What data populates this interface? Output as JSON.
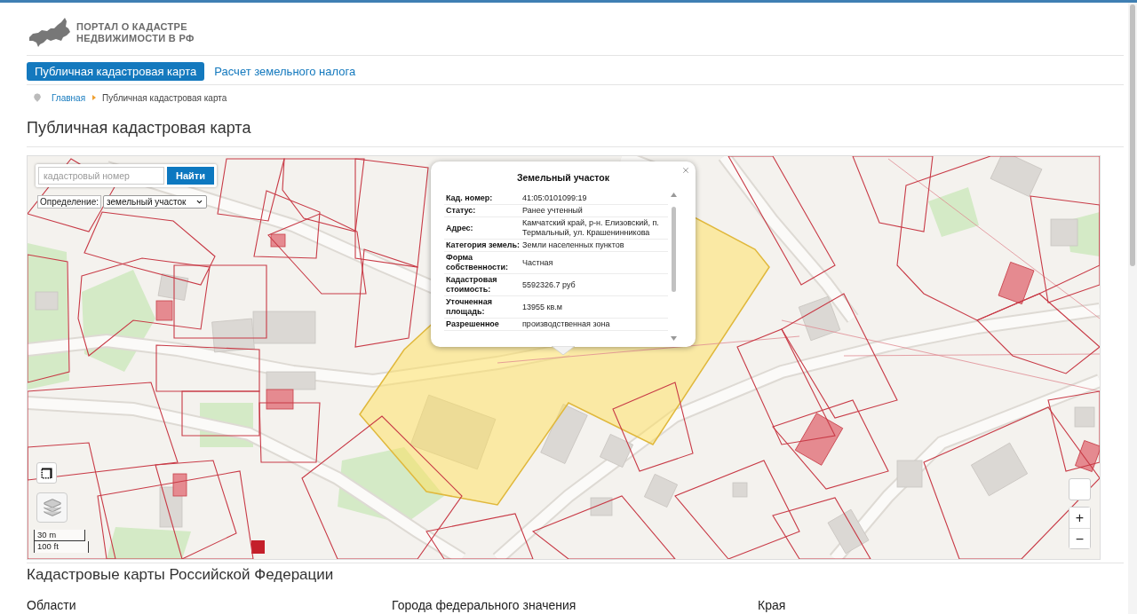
{
  "header": {
    "site_title": [
      "ПОРТАЛ О КАДАСТРЕ",
      "НЕДВИЖИМОСТИ В РФ"
    ]
  },
  "nav": [
    {
      "label": "Публичная кадастровая карта",
      "selected": true
    },
    {
      "label": "Расчет земельного налога",
      "selected": false
    }
  ],
  "breadcrumbs": [
    {
      "label": "Главная",
      "kind": "link"
    },
    {
      "label": "Публичная кадастровая карта",
      "kind": "current"
    }
  ],
  "page_title": "Публичная кадастровая карта",
  "map": {
    "search": {
      "placeholder": "кадастровый номер",
      "button": "Найти"
    },
    "mode": {
      "label": "Определение:",
      "value": "земельный участок"
    },
    "popup": {
      "title": "Земельный участок",
      "rows": [
        {
          "label": "Кад. номер:",
          "value": "41:05:0101099:19"
        },
        {
          "label": "Статус:",
          "value": "Ранее учтенный"
        },
        {
          "label": "Адрес:",
          "value": "Камчатский край, р-н. Елизовский, п. Термальный, ул. Крашенинникова"
        },
        {
          "label": "Категория земель:",
          "value": "Земли населенных пунктов"
        },
        {
          "label": "Форма собственности:",
          "value": "Частная"
        },
        {
          "label": "Кадастровая стоимость:",
          "value": "5592326.7 руб"
        },
        {
          "label": "Уточненная площадь:",
          "value": "13955 кв.м"
        },
        {
          "label": "Разрешенное",
          "value": "производственная зона"
        }
      ]
    },
    "scale": [
      "30 m",
      "100 ft"
    ],
    "zoom": [
      "+",
      "−"
    ]
  },
  "section": {
    "title": "Кадастровые карты Российской Федерации",
    "columns": [
      "Области",
      "Города федерального значения",
      "Края"
    ]
  }
}
